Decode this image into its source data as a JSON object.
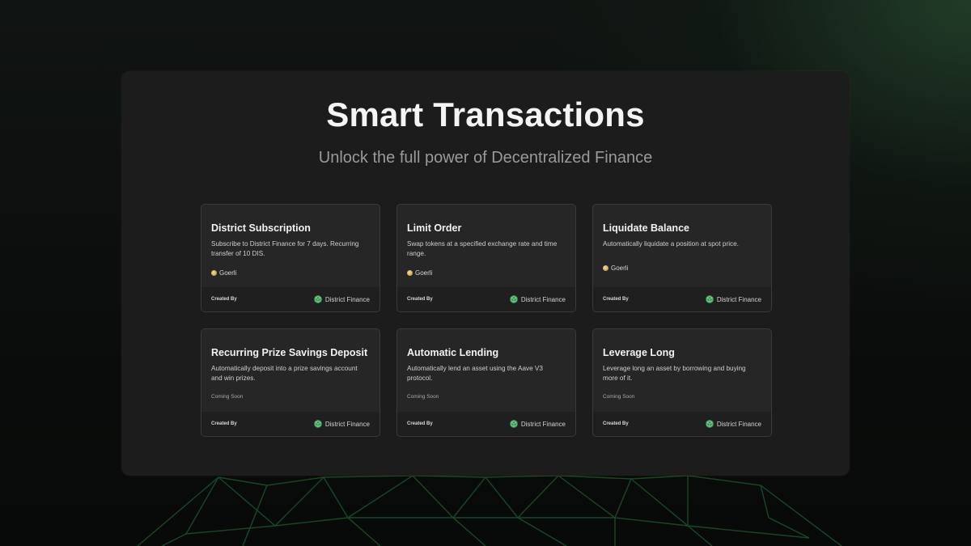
{
  "header": {
    "title": "Smart Transactions",
    "subtitle": "Unlock the full power of Decentralized Finance"
  },
  "cards": [
    {
      "title": "District Subscription",
      "description": "Subscribe to District Finance for 7 days. Recurring transfer of 10 DIS.",
      "meta": "Goerli",
      "meta_icon": "goerli-network-icon",
      "created_by_label": "Created By",
      "creator": "District Finance",
      "creator_icon": "district-finance-logo-icon"
    },
    {
      "title": "Limit Order",
      "description": "Swap tokens at a specified exchange rate and time range.",
      "meta": "Goerli",
      "meta_icon": "goerli-network-icon",
      "created_by_label": "Created By",
      "creator": "District Finance",
      "creator_icon": "district-finance-logo-icon"
    },
    {
      "title": "Liquidate Balance",
      "description": "Automatically liquidate a position at spot price.",
      "meta": "Goerli",
      "meta_icon": "goerli-network-icon",
      "created_by_label": "Created By",
      "creator": "District Finance",
      "creator_icon": "district-finance-logo-icon"
    },
    {
      "title": "Recurring Prize Savings Deposit",
      "description": "Automatically deposit into a prize savings account and win prizes.",
      "meta": "Coming Soon",
      "created_by_label": "Created By",
      "creator": "District Finance",
      "creator_icon": "district-finance-logo-icon"
    },
    {
      "title": "Automatic Lending",
      "description": "Automatically lend an asset using the Aave V3 protocol.",
      "meta": "Coming Soon",
      "created_by_label": "Created By",
      "creator": "District Finance",
      "creator_icon": "district-finance-logo-icon"
    },
    {
      "title": "Leverage Long",
      "description": "Leverage long an asset by borrowing and buying more of it.",
      "meta": "Coming Soon",
      "created_by_label": "Created By",
      "creator": "District Finance",
      "creator_icon": "district-finance-logo-icon"
    }
  ],
  "colors": {
    "background": "#0b0d0c",
    "panel": "#1c1c1c",
    "card": "#262626",
    "card_footer": "#1f1f1f",
    "accent_green": "#2f8f4a"
  }
}
